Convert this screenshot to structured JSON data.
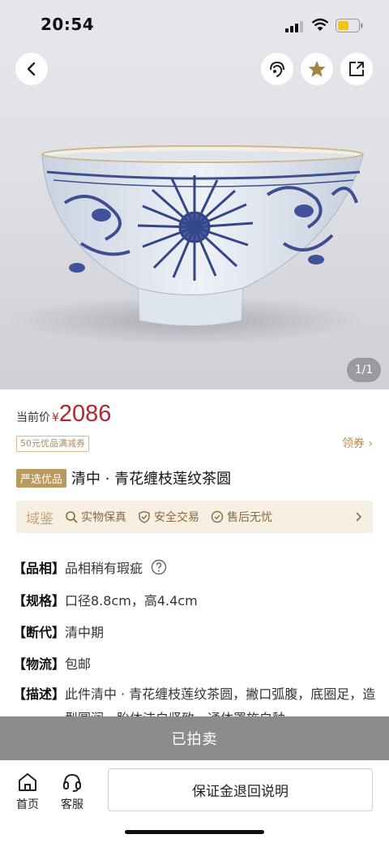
{
  "status": {
    "time": "20:54"
  },
  "hero": {
    "image_counter": "1/1"
  },
  "price": {
    "label": "当前价",
    "currency": "¥",
    "value": "2086"
  },
  "coupon": {
    "tag": "50元优品满减券",
    "action": "领券 ›"
  },
  "title": {
    "badge": "严选优品",
    "text": "清中 · 青花缠枝莲纹茶圆"
  },
  "guarantee": {
    "brand": "域鉴",
    "items": [
      "实物保真",
      "安全交易",
      "售后无忧"
    ]
  },
  "details": [
    {
      "key": "【品相】",
      "value": "品相稍有瑕疵"
    },
    {
      "key": "【规格】",
      "value": "口径8.8cm，高4.4cm"
    },
    {
      "key": "【断代】",
      "value": "清中期"
    },
    {
      "key": "【物流】",
      "value": "包邮"
    },
    {
      "key": "【描述】",
      "value": "此件清中 · 青花缠枝莲纹茶圆，撇口弧腹，底圈足，造型圆润，胎体洁白坚致，通体罩施白釉"
    }
  ],
  "sold_bar": "已拍卖",
  "bottom_nav": {
    "home": "首页",
    "service": "客服",
    "deposit_button": "保证金退回说明"
  },
  "icons": {
    "back": "chevron-left-icon",
    "customer_service": "headset-icon",
    "favorite": "star-icon",
    "share": "share-icon"
  },
  "colors": {
    "price": "#b5272b",
    "accent_gold": "#b99960",
    "sold_bar": "#8c8c8c"
  }
}
